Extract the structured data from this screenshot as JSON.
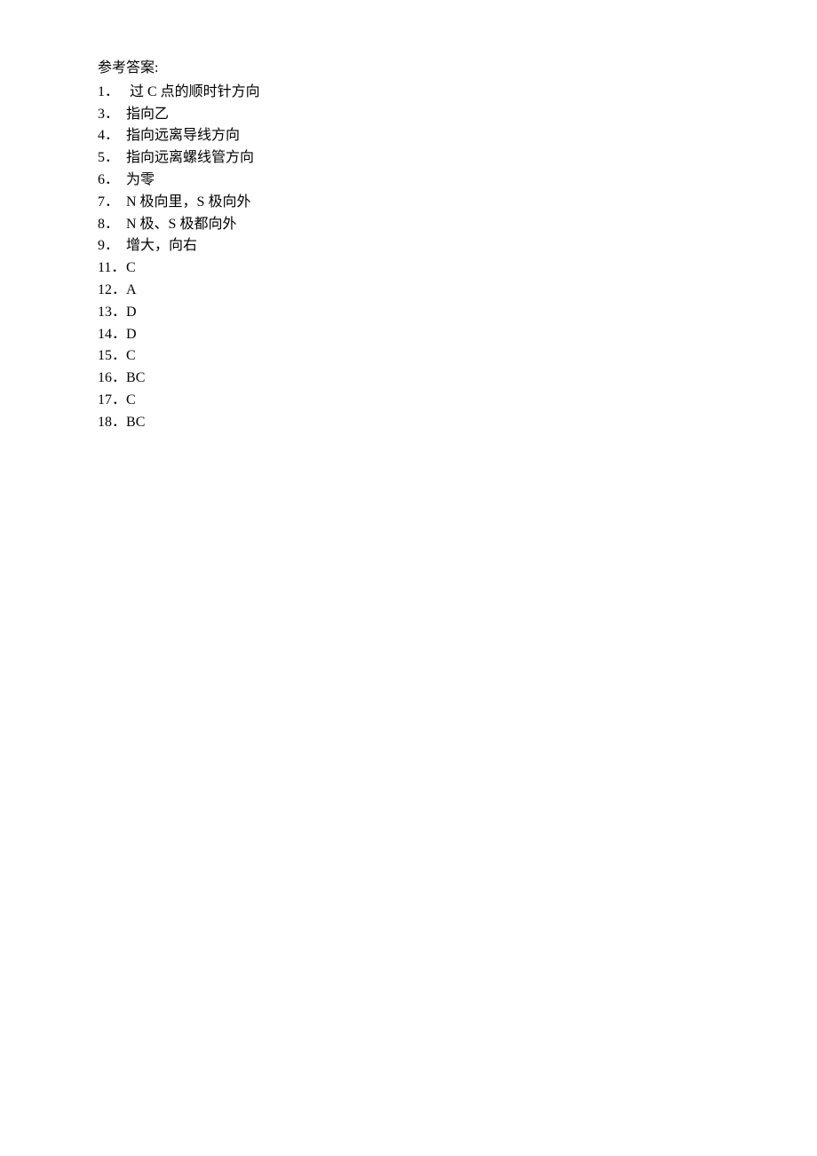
{
  "title": "参考答案:",
  "answers": [
    {
      "num": "1．",
      "content": " 过 C 点的顺时针方向"
    },
    {
      "num": "3．",
      "content": "指向乙"
    },
    {
      "num": "4．",
      "content": "指向远离导线方向"
    },
    {
      "num": "5．",
      "content": "指向远离螺线管方向"
    },
    {
      "num": "6．",
      "content": "为零"
    },
    {
      "num": "7．",
      "content": "N 极向里，S 极向外"
    },
    {
      "num": "8．",
      "content": "N 极、S 极都向外"
    },
    {
      "num": "9．",
      "content": "增大，向右"
    },
    {
      "num": "11．",
      "content": "C"
    },
    {
      "num": "12．",
      "content": "A"
    },
    {
      "num": "13．",
      "content": "D"
    },
    {
      "num": "14．",
      "content": "D"
    },
    {
      "num": "15．",
      "content": "C"
    },
    {
      "num": "16．",
      "content": "BC"
    },
    {
      "num": "17．",
      "content": "C"
    },
    {
      "num": "18．",
      "content": "BC"
    }
  ]
}
